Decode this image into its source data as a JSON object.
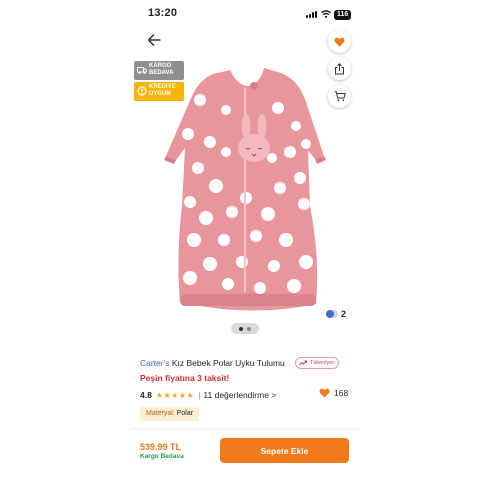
{
  "status_bar": {
    "time": "13:20",
    "battery": "116"
  },
  "badges": {
    "free_shipping": "KARGO BEDAVA",
    "credit": "KREDİYE UYGUN"
  },
  "gallery": {
    "current_page": 1,
    "total_pages": 2,
    "color_count": "2",
    "colors": [
      "#3b6fd1",
      "#cfd6e6"
    ]
  },
  "product": {
    "brand": "Carter's",
    "name": " Kız Bebek Polar Uyku Tulumu",
    "selling_badge": "Tükeniyor",
    "promo": "Peşin fiyatına 3 taksit!",
    "rating": "4.8",
    "stars": "★★★★★",
    "reviews": "11 değerlendirme >",
    "favorites": "168",
    "material_label": "Materyal:",
    "material_value": "Polar"
  },
  "footer": {
    "price": "539.99 TL",
    "shipping": "Kargo Bedava",
    "add_to_cart": "Sepete Ekle"
  },
  "colors": {
    "accent": "#f27a1a",
    "garment": "#e9959c"
  }
}
